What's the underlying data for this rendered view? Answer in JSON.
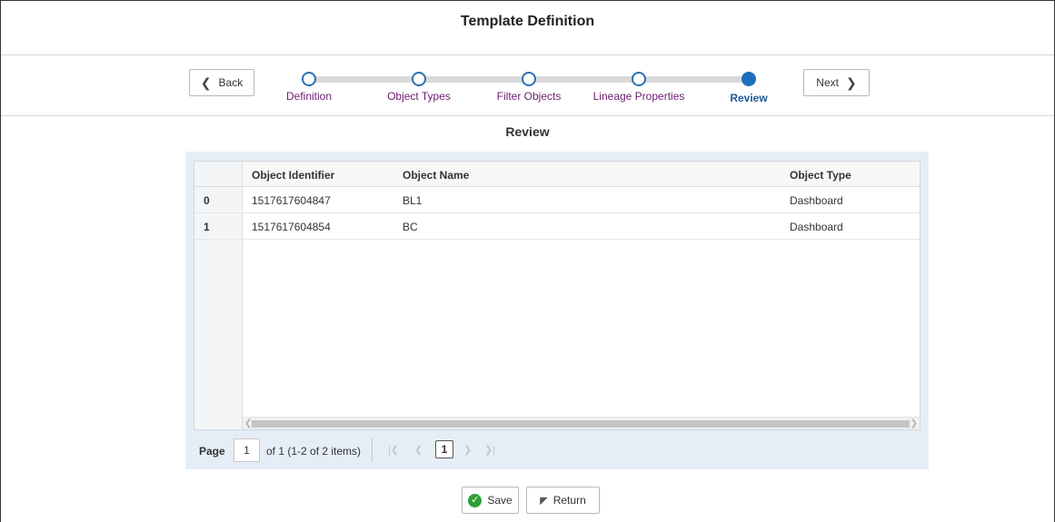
{
  "header": {
    "title": "Template Definition"
  },
  "train": {
    "back_label": "Back",
    "next_label": "Next",
    "steps": [
      {
        "label": "Definition",
        "active": false
      },
      {
        "label": "Object Types",
        "active": false
      },
      {
        "label": "Filter Objects",
        "active": false
      },
      {
        "label": "Lineage Properties",
        "active": false
      },
      {
        "label": "Review",
        "active": true
      }
    ]
  },
  "section": {
    "title": "Review"
  },
  "table": {
    "columns": [
      "Object Identifier",
      "Object Name",
      "Object Type"
    ],
    "rows": [
      {
        "index": "0",
        "identifier": "1517617604847",
        "name": "BL1",
        "type": "Dashboard"
      },
      {
        "index": "1",
        "identifier": "1517617604854",
        "name": "BC",
        "type": "Dashboard"
      }
    ]
  },
  "pager": {
    "page_label": "Page",
    "page_value": "1",
    "summary": "of 1 (1-2 of 2 items)",
    "current_page": "1"
  },
  "footer": {
    "save_label": "Save",
    "return_label": "Return"
  },
  "colors": {
    "active_step": "#1e6ec0",
    "step_label": "#6a1b6f",
    "panel_bg": "#e5eef7",
    "save_icon": "#2f9e3a"
  },
  "icons": {
    "back": "chevron-left-icon",
    "next": "chevron-right-icon",
    "save": "check-circle-icon",
    "return": "return-arrow-icon"
  }
}
